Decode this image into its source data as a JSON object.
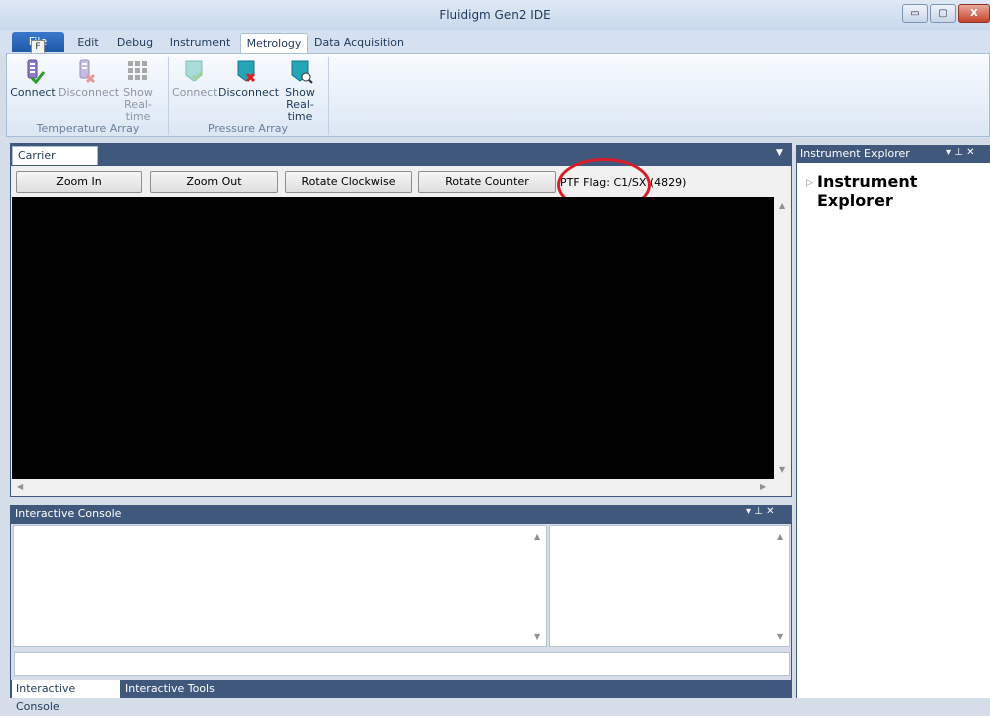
{
  "window": {
    "title": "Fluidigm Gen2 IDE",
    "min_glyph": "▭",
    "max_glyph": "▢",
    "close_glyph": "X"
  },
  "ribbon": {
    "file_tab": "File",
    "file_key": "F",
    "tabs": [
      {
        "label": "Edit"
      },
      {
        "label": "Debug"
      },
      {
        "label": "Instrument"
      },
      {
        "label": "Metrology",
        "active": true
      },
      {
        "label": "Data Acquisition"
      }
    ],
    "groups": [
      {
        "label": "Temperature Array",
        "buttons": [
          {
            "label": "Connect",
            "icon": "thermometer-connect-icon",
            "enabled": true
          },
          {
            "label": "Disconnect",
            "icon": "thermometer-disconnect-icon",
            "enabled": false
          },
          {
            "label": "Show Real-time",
            "icon": "grid-realtime-icon",
            "enabled": false
          }
        ]
      },
      {
        "label": "Pressure Array",
        "buttons": [
          {
            "label": "Connect",
            "icon": "pressure-connect-icon",
            "enabled": false
          },
          {
            "label": "Disconnect",
            "icon": "pressure-disconnect-icon",
            "enabled": true
          },
          {
            "label": "Show Real-time",
            "icon": "pressure-realtime-icon",
            "enabled": true
          }
        ]
      }
    ]
  },
  "carrier_view": {
    "tab_label": "Carrier View",
    "close_glyph": "✕",
    "buttons": {
      "zoom_in": "Zoom In",
      "zoom_out": "Zoom Out",
      "rotate_cw": "Rotate Clockwise",
      "rotate_ccw": "Rotate Counter Clockwise"
    },
    "ptf_flag": "PTF Flag: C1/SX (4829)"
  },
  "console": {
    "title": "Interactive Console",
    "controls": "▾ ⊥ ✕",
    "tabs": [
      "Interactive Console",
      "Interactive Tools"
    ]
  },
  "explorer": {
    "title": "Instrument Explorer",
    "controls": "▾ ⊥ ✕",
    "tree_root": "Instrument Explorer"
  },
  "colors": {
    "accent": "#41587d",
    "annotation": "#d81c28",
    "file_tab": "#1f58a8"
  }
}
